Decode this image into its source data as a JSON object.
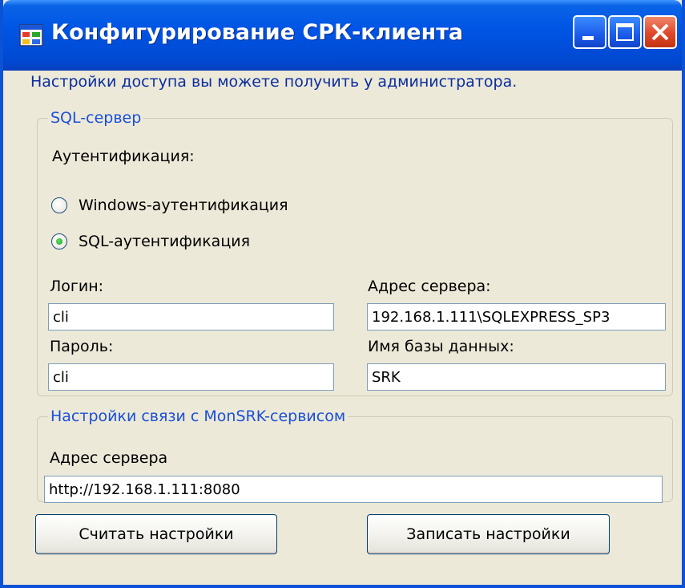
{
  "window": {
    "title": "Конфигурирование СРК-клиента",
    "icon": "app-window-icon",
    "controls": [
      "minimize-icon",
      "maximize-icon",
      "close-icon"
    ]
  },
  "info_text": "Настройки доступа вы можете получить у администратора.",
  "sql_group": {
    "legend": "SQL-сервер",
    "auth_label": "Аутентификация:",
    "auth_options": [
      {
        "label": "Windows-аутентификация",
        "checked": false
      },
      {
        "label": "SQL-аутентификация",
        "checked": true
      }
    ],
    "login_label": "Логин:",
    "login_value": "cli",
    "password_label": "Пароль:",
    "password_value": "cli",
    "server_label": "Адрес сервера:",
    "server_value": "192.168.1.111\\SQLEXPRESS_SP3",
    "db_label": "Имя базы данных:",
    "db_value": "SRK"
  },
  "mon_group": {
    "legend": "Настройки связи с MonSRK-сервисом",
    "server_label": "Адрес сервера",
    "server_value": "http://192.168.1.111:8080"
  },
  "buttons": {
    "read": "Считать настройки",
    "write": "Записать настройки"
  },
  "colors": {
    "titlebar": "#0055e5",
    "accent_text": "#1a4fd8",
    "close_button": "#e0472a",
    "background": "#ece9d8"
  }
}
